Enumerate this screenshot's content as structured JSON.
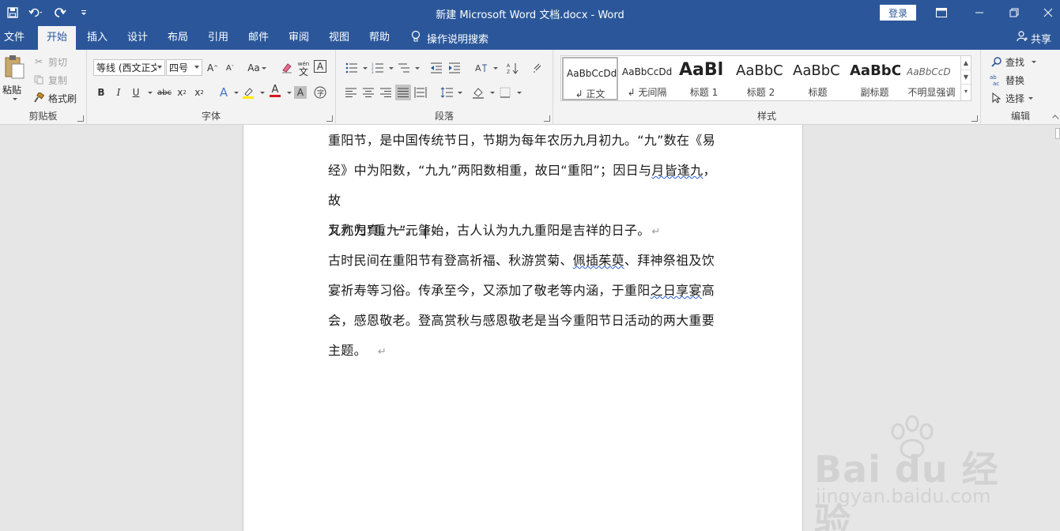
{
  "window": {
    "title": "新建 Microsoft Word 文档.docx  -  Word",
    "login_label": "登录"
  },
  "tabs": [
    {
      "label": "文件"
    },
    {
      "label": "开始"
    },
    {
      "label": "插入"
    },
    {
      "label": "设计"
    },
    {
      "label": "布局"
    },
    {
      "label": "引用"
    },
    {
      "label": "邮件"
    },
    {
      "label": "审阅"
    },
    {
      "label": "视图"
    },
    {
      "label": "帮助"
    }
  ],
  "tell_me": "操作说明搜索",
  "share_label": "共享",
  "clipboard": {
    "paste": "粘贴",
    "cut": "剪切",
    "copy": "复制",
    "format_painter": "格式刷",
    "label": "剪贴板"
  },
  "font": {
    "name": "等线 (西文正文",
    "size": "四号",
    "label": "字体",
    "case_label": "Aa",
    "pinyin_label": "wén",
    "pinyin_char": "文"
  },
  "paragraph": {
    "label": "段落"
  },
  "styles": {
    "label": "样式",
    "items": [
      {
        "preview": "AaBbCcDd",
        "name": "↲ 正文"
      },
      {
        "preview": "AaBbCcDd",
        "name": "↲ 无间隔"
      },
      {
        "preview": "AaBl",
        "name": "标题 1"
      },
      {
        "preview": "AaBbC",
        "name": "标题 2"
      },
      {
        "preview": "AaBbC",
        "name": "标题"
      },
      {
        "preview": "AaBbC",
        "name": "副标题"
      },
      {
        "preview": "AaBbCcD",
        "name": "不明显强调"
      }
    ]
  },
  "editing": {
    "find": "查找",
    "replace": "替换",
    "select": "选择",
    "label": "编辑"
  },
  "document": {
    "p1_l1": "重阳节，是中国传统节日，节期为每年农历九月初九。“九”数在《易",
    "p1_l2a": "经》中为阳数，“九九”两阳数相重，故曰“重阳”；因日与",
    "p1_l2b": "月皆逢九",
    "p1_l2c": "，故",
    "p1_l3": "又称为“重九”。",
    "p2": "九九归真，一元肇始，古人认为九九重阳是吉祥的日子。",
    "p3_l1a": "古时民间在重阳节有登高祈福、秋游赏菊、",
    "p3_l1b": "佩插茱萸",
    "p3_l1c": "、拜神祭祖及饮",
    "p3_l2a": "宴祈寿等习俗。传承至今，又添加了敬老等内涵，于重阳",
    "p3_l2b": "之日享宴",
    "p3_l2c": "高",
    "p3_l3": "会，感恩敬老。登高赏秋与感恩敬老是当今重阳节日活动的两大重要",
    "p3_l4": "主题。",
    "pilcrow": "↵"
  },
  "watermark": {
    "main": "Bai du 经验",
    "sub": "jingyan.baidu.com"
  }
}
